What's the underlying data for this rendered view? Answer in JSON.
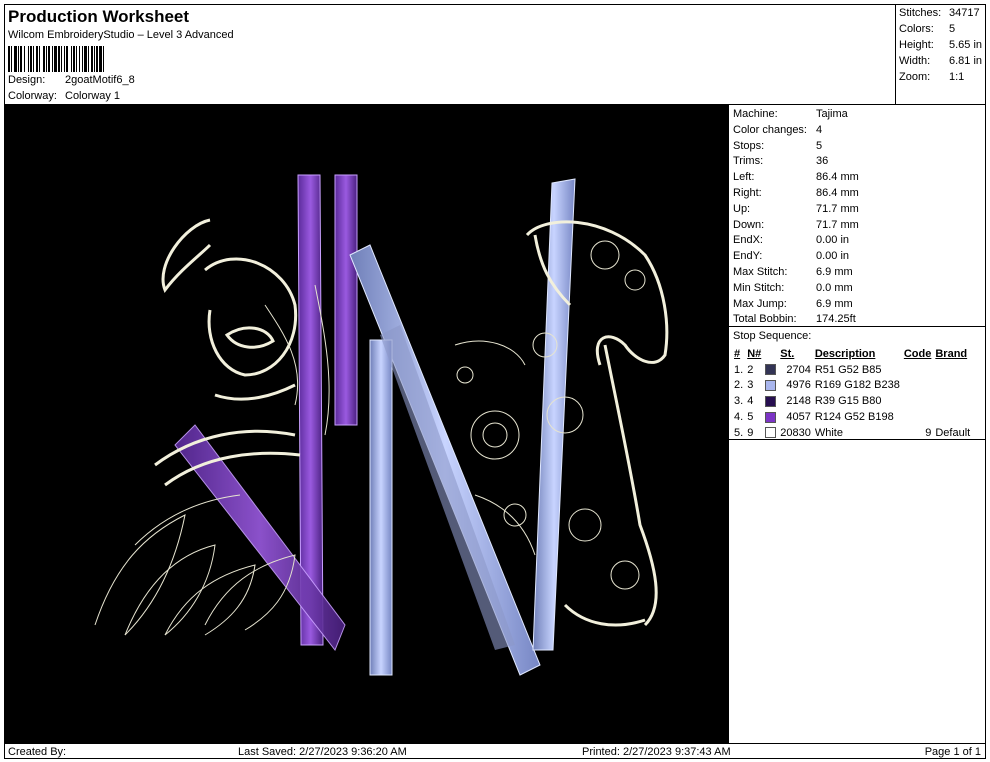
{
  "header": {
    "title": "Production Worksheet",
    "software": "Wilcom EmbroideryStudio – Level 3 Advanced",
    "design_label": "Design:",
    "design_value": "2goatMotif6_8",
    "colorway_label": "Colorway:",
    "colorway_value": "Colorway 1"
  },
  "summary": {
    "stitches_label": "Stitches:",
    "stitches": "34717",
    "colors_label": "Colors:",
    "colors": "5",
    "height_label": "Height:",
    "height": "5.65 in",
    "width_label": "Width:",
    "width": "6.81 in",
    "zoom_label": "Zoom:",
    "zoom": "1:1"
  },
  "stats": [
    {
      "label": "Machine:",
      "value": "Tajima"
    },
    {
      "label": "Color changes:",
      "value": "4"
    },
    {
      "label": "Stops:",
      "value": "5"
    },
    {
      "label": "Trims:",
      "value": "36"
    },
    {
      "label": "Left:",
      "value": "86.4 mm"
    },
    {
      "label": "Right:",
      "value": "86.4 mm"
    },
    {
      "label": "Up:",
      "value": "71.7 mm"
    },
    {
      "label": "Down:",
      "value": "71.7 mm"
    },
    {
      "label": "EndX:",
      "value": "0.00 in"
    },
    {
      "label": "EndY:",
      "value": "0.00 in"
    },
    {
      "label": "Max Stitch:",
      "value": "6.9 mm"
    },
    {
      "label": "Min Stitch:",
      "value": "0.0 mm"
    },
    {
      "label": "Max Jump:",
      "value": "6.9 mm"
    },
    {
      "label": "Total Bobbin:",
      "value": "174.25ft"
    }
  ],
  "stop_sequence": {
    "title": "Stop Sequence:",
    "headers": {
      "num": "#",
      "n": "N#",
      "st": "St.",
      "desc": "Description",
      "code": "Code",
      "brand": "Brand"
    },
    "rows": [
      {
        "num": "1.",
        "n": "2",
        "color": "#333455",
        "st": "2704",
        "desc": "R51 G52 B85",
        "code": "",
        "brand": ""
      },
      {
        "num": "2.",
        "n": "3",
        "color": "#A9B6EE",
        "st": "4976",
        "desc": "R169 G182 B238",
        "code": "",
        "brand": ""
      },
      {
        "num": "3.",
        "n": "4",
        "color": "#270F50",
        "st": "2148",
        "desc": "R39 G15 B80",
        "code": "",
        "brand": ""
      },
      {
        "num": "4.",
        "n": "5",
        "color": "#7C34C6",
        "st": "4057",
        "desc": "R124 G52 B198",
        "code": "",
        "brand": ""
      },
      {
        "num": "5.",
        "n": "9",
        "color": "#FFFFFF",
        "st": "20830",
        "desc": "White",
        "code": "9",
        "brand": "Default"
      }
    ]
  },
  "footer": {
    "created_by": "Created By:",
    "last_saved": "Last Saved: 2/27/2023 9:36:20 AM",
    "printed": "Printed: 2/27/2023 9:37:43 AM",
    "page": "Page 1 of 1"
  }
}
